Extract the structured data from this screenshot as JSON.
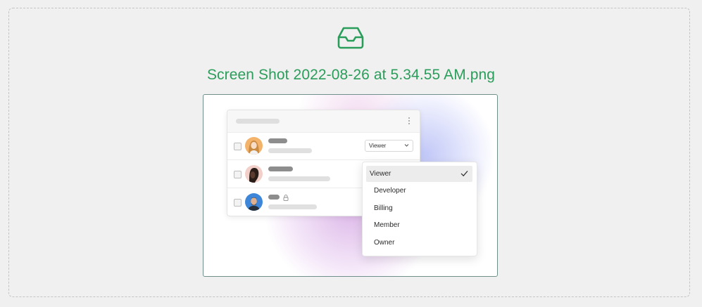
{
  "upload": {
    "icon": "inbox-icon",
    "file_name": "Screen Shot 2022-08-26 at 5.34.55 AM.png",
    "accent_color": "#2a9d5a"
  },
  "preview": {
    "role_select": {
      "value": "Viewer",
      "icon": "chevron-down-icon"
    },
    "users": [
      {
        "avatar": "woman-avatar",
        "locked": false
      },
      {
        "avatar": "person-avatar",
        "locked": false
      },
      {
        "avatar": "man-avatar",
        "locked": true
      }
    ],
    "role_menu": {
      "options": [
        "Viewer",
        "Developer",
        "Billing",
        "Member",
        "Owner"
      ],
      "selected": "Viewer",
      "selected_icon": "check-icon"
    }
  }
}
